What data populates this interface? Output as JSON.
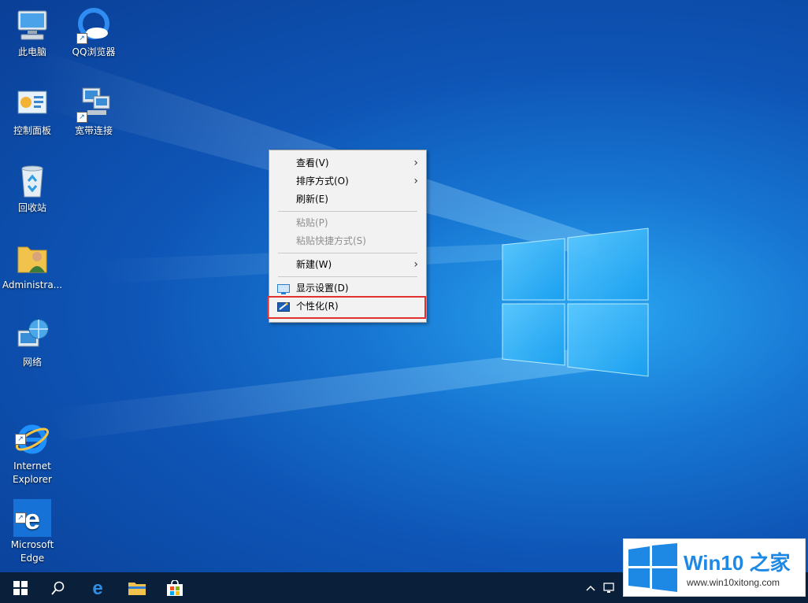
{
  "desktop": {
    "icons": [
      {
        "label": "此电脑"
      },
      {
        "label": "QQ浏览器"
      },
      {
        "label": "控制面板"
      },
      {
        "label": "宽带连接"
      },
      {
        "label": "回收站"
      },
      {
        "label": "Administra..."
      },
      {
        "label": "网络"
      },
      {
        "label": "Internet\nExplorer"
      },
      {
        "label": "Microsoft\nEdge"
      }
    ]
  },
  "context_menu": {
    "items": [
      {
        "label": "查看(V)",
        "enabled": true,
        "submenu": true
      },
      {
        "label": "排序方式(O)",
        "enabled": true,
        "submenu": true
      },
      {
        "label": "刷新(E)",
        "enabled": true,
        "submenu": false
      },
      {
        "label": "粘贴(P)",
        "enabled": false,
        "submenu": false
      },
      {
        "label": "粘贴快捷方式(S)",
        "enabled": false,
        "submenu": false
      },
      {
        "label": "新建(W)",
        "enabled": true,
        "submenu": true
      },
      {
        "label": "显示设置(D)",
        "enabled": true,
        "submenu": false
      },
      {
        "label": "个性化(R)",
        "enabled": true,
        "submenu": false,
        "highlighted": true
      }
    ],
    "highlight_color": "#e03030"
  },
  "taskbar": {
    "buttons": [
      "windows-start-icon",
      "search-icon",
      "edge-icon",
      "file-explorer-icon",
      "store-icon"
    ],
    "tray": [
      "chevron-up-icon",
      "network-icon"
    ]
  },
  "watermark": {
    "title": "Win10 之家",
    "url": "www.win10xitong.com"
  },
  "colors": {
    "desktop_accent": "#1776d2",
    "taskbar": "#0a1f3a",
    "menu_bg": "#f2f2f2"
  }
}
